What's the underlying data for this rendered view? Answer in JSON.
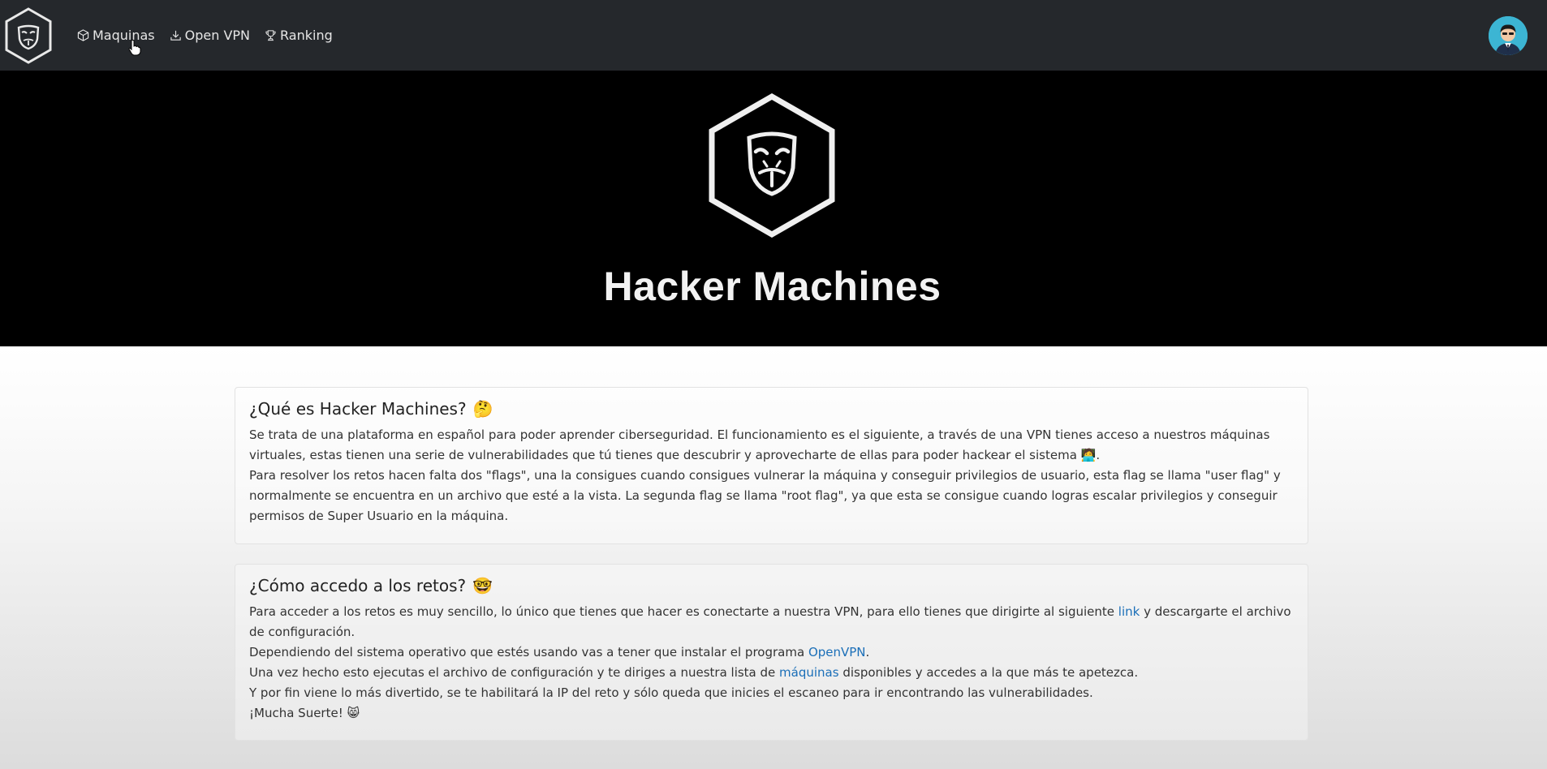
{
  "navbar": {
    "logo": "hacker-mask-hexagon-logo",
    "links": [
      {
        "label": "Maquinas",
        "icon": "cube-icon"
      },
      {
        "label": "Open VPN",
        "icon": "download-icon"
      },
      {
        "label": "Ranking",
        "icon": "trophy-icon"
      }
    ],
    "avatar": "user-avatar"
  },
  "hero": {
    "logo": "hacker-mask-hexagon-logo",
    "title": "Hacker Machines"
  },
  "cards": {
    "what": {
      "title": "¿Qué es Hacker Machines?",
      "title_emoji": "🤔",
      "p1": "Se trata de una plataforma en español para poder aprender ciberseguridad. El funcionamiento es el siguiente, a través de una VPN tienes acceso a nuestros máquinas virtuales, estas tienen una serie de vulnerabilidades que tú tienes que descubrir y aprovecharte de ellas para poder hackear el sistema",
      "p1_emoji": "🧑‍💻",
      "p1_end": ".",
      "p2": "Para resolver los retos hacen falta dos \"flags\", una la consigues cuando consigues vulnerar la máquina y conseguir privilegios de usuario, esta flag se llama \"user flag\" y normalmente se encuentra en un archivo que esté a la vista. La segunda flag se llama \"root flag\", ya que esta se consigue cuando logras escalar privilegios y conseguir permisos de Super Usuario en la máquina."
    },
    "how": {
      "title": "¿Cómo accedo a los retos?",
      "title_emoji": "🤓",
      "l1_a": "Para acceder a los retos es muy sencillo, lo único que tienes que hacer es conectarte a nuestra VPN, para ello tienes que dirigirte al siguiente ",
      "l1_link": "link",
      "l1_b": " y descargarte el archivo de configuración.",
      "l2_a": "Dependiendo del sistema operativo que estés usando vas a tener que instalar el programa ",
      "l2_link": "OpenVPN",
      "l2_b": ".",
      "l3_a": "Una vez hecho esto ejecutas el archivo de configuración y te diriges a nuestra lista de ",
      "l3_link": "máquinas",
      "l3_b": " disponibles y accedes a la que más te apetezca.",
      "l4": "Y por fin viene lo más divertido, se te habilitará la IP del reto y sólo queda que inicies el escaneo para ir encontrando las vulnerabilidades.",
      "l5": "¡Mucha Suerte!",
      "l5_emoji": "😸"
    }
  },
  "colors": {
    "navbar_bg": "#25282c",
    "hero_bg": "#000000",
    "link": "#1b6fb8"
  }
}
